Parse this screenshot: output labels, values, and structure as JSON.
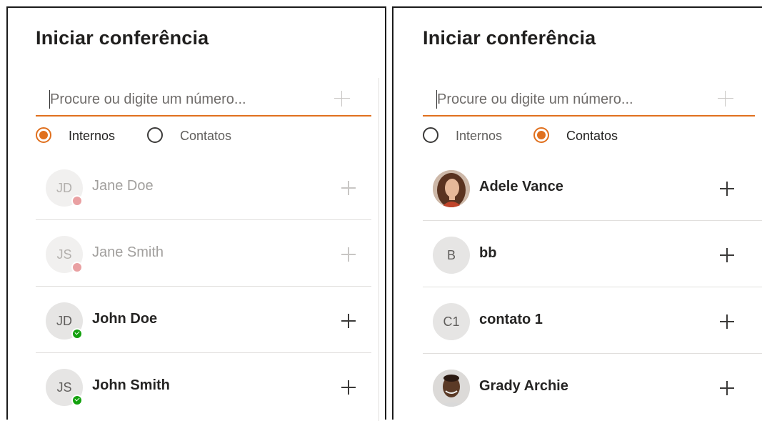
{
  "left_panel": {
    "title": "Iniciar conferência",
    "search": {
      "placeholder": "Procure ou digite um número...",
      "value": ""
    },
    "radios": [
      {
        "label": "Internos",
        "selected": true
      },
      {
        "label": "Contatos",
        "selected": false
      }
    ],
    "rows": [
      {
        "initials": "JD",
        "name": "Jane Doe",
        "presence": "away",
        "offline": true
      },
      {
        "initials": "JS",
        "name": "Jane Smith",
        "presence": "away",
        "offline": true
      },
      {
        "initials": "JD",
        "name": "John Doe",
        "presence": "available",
        "offline": false
      },
      {
        "initials": "JS",
        "name": "John Smith",
        "presence": "available",
        "offline": false
      }
    ]
  },
  "right_panel": {
    "title": "Iniciar conferência",
    "search": {
      "placeholder": "Procure ou digite um número...",
      "value": ""
    },
    "radios": [
      {
        "label": "Internos",
        "selected": false
      },
      {
        "label": "Contatos",
        "selected": true
      }
    ],
    "rows": [
      {
        "initials": "",
        "name": "Adele Vance",
        "avatar": "photo-adele"
      },
      {
        "initials": "B",
        "name": "bb",
        "avatar": "initials"
      },
      {
        "initials": "C1",
        "name": "contato 1",
        "avatar": "initials"
      },
      {
        "initials": "",
        "name": "Grady Archie",
        "avatar": "photo-grady"
      }
    ]
  },
  "colors": {
    "accent": "#e0701e",
    "available": "#13a10e",
    "away": "#e9a0a2"
  },
  "icons": {
    "add": "plus-icon",
    "search_add": "plus-icon"
  }
}
